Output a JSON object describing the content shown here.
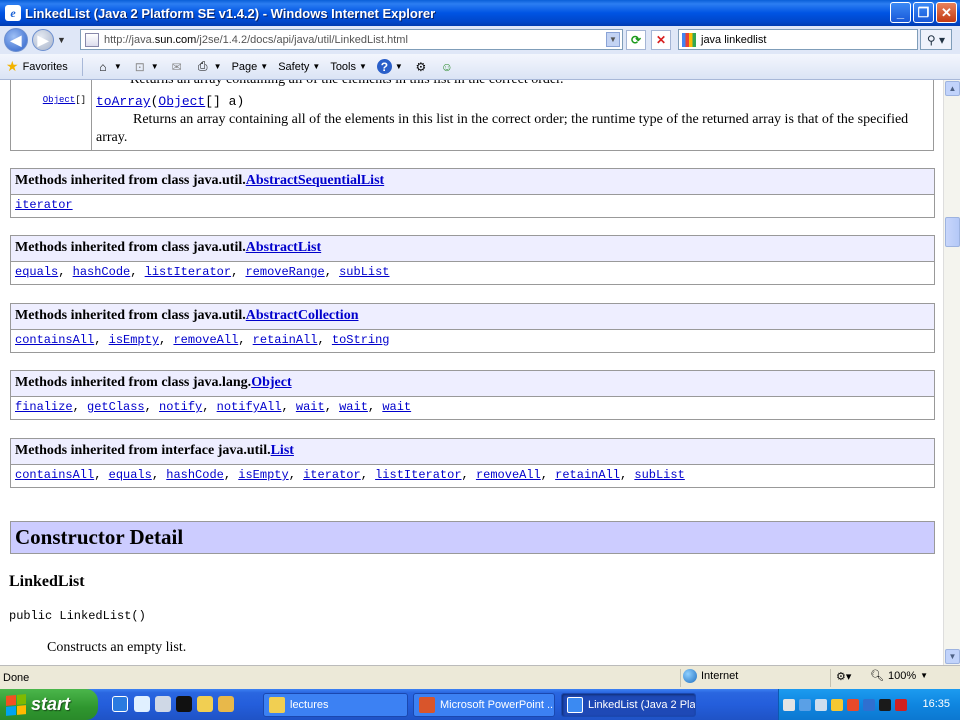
{
  "window": {
    "title": "LinkedList (Java 2 Platform SE v1.4.2) - Windows Internet Explorer"
  },
  "address_bar": {
    "url_prefix": "http://java.",
    "url_host": "sun.com",
    "url_path": "/j2se/1.4.2/docs/api/java/util/LinkedList.html",
    "search_value": "java linkedlist"
  },
  "command_bar": {
    "favorites_label": "Favorites",
    "page_label": "Page",
    "safety_label": "Safety",
    "tools_label": "Tools"
  },
  "content": {
    "top_cut_text": "Returns an array containing all of the elements in this list in the correct order.",
    "method": {
      "return_type": "Object",
      "return_suffix": "[]",
      "name": "toArray",
      "param_type": "Object",
      "param_rest": "[] a)",
      "desc": "Returns an array containing all of the elements in this list in the correct order; the runtime type of the returned array is that of the specified array."
    },
    "inherited": [
      {
        "prefix": "Methods inherited from class java.util.",
        "link": "AbstractSequentialList",
        "methods": [
          "iterator"
        ]
      },
      {
        "prefix": "Methods inherited from class java.util.",
        "link": "AbstractList",
        "methods": [
          "equals",
          "hashCode",
          "listIterator",
          "removeRange",
          "subList"
        ]
      },
      {
        "prefix": "Methods inherited from class java.util.",
        "link": "AbstractCollection",
        "methods": [
          "containsAll",
          "isEmpty",
          "removeAll",
          "retainAll",
          "toString"
        ]
      },
      {
        "prefix": "Methods inherited from class java.lang.",
        "link": "Object",
        "methods": [
          "finalize",
          "getClass",
          "notify",
          "notifyAll",
          "wait",
          "wait",
          "wait"
        ]
      },
      {
        "prefix": "Methods inherited from interface java.util.",
        "link": "List",
        "methods": [
          "containsAll",
          "equals",
          "hashCode",
          "isEmpty",
          "iterator",
          "listIterator",
          "removeAll",
          "retainAll",
          "subList"
        ]
      }
    ],
    "constructor_header": "Constructor Detail",
    "constructor_name": "LinkedList",
    "constructor_sig": "public LinkedList()",
    "constructor_desc": "Constructs an empty list."
  },
  "status_bar": {
    "status": "Done",
    "zone": "Internet",
    "zoom": "100%"
  },
  "taskbar": {
    "start_label": "start",
    "tasks": [
      {
        "label": "lectures"
      },
      {
        "label": "Microsoft PowerPoint ..."
      },
      {
        "label": "LinkedList (Java 2 Pla..."
      }
    ],
    "clock": "16:35"
  }
}
